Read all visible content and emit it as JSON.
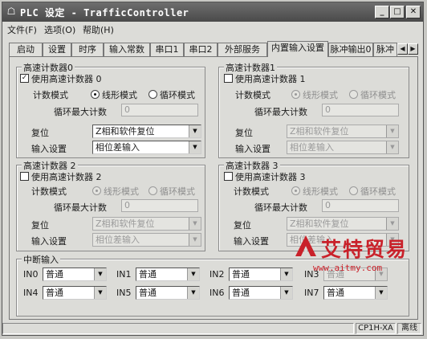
{
  "window": {
    "icon": "plc-icon",
    "title": "PLC 设定 - TrafficController"
  },
  "menu": [
    "文件(F)",
    "选项(O)",
    "帮助(H)"
  ],
  "tabs": [
    "启动",
    "设置",
    "时序",
    "输入常数",
    "串口1",
    "串口2",
    "外部服务",
    "内置输入设置",
    "脉冲输出0",
    "脉冲"
  ],
  "active_tab": "内置输入设置",
  "counters": [
    {
      "title": "高速计数器0",
      "use_label": "使用高速计数器 0",
      "use_checked": true,
      "mode_label": "计数模式",
      "mode_linear": "线形模式",
      "mode_loop": "循环模式",
      "mode_selected": "linear",
      "enabled": true,
      "max_label": "循环最大计数",
      "max_value": "0",
      "reset_label": "复位",
      "reset_value": "Z相和软件复位",
      "input_label": "输入设置",
      "input_value": "相位差输入"
    },
    {
      "title": "高速计数器1",
      "use_label": "使用高速计数器 1",
      "use_checked": false,
      "mode_label": "计数模式",
      "mode_linear": "线形模式",
      "mode_loop": "循环模式",
      "mode_selected": "linear",
      "enabled": false,
      "max_label": "循环最大计数",
      "max_value": "0",
      "reset_label": "复位",
      "reset_value": "Z相和软件复位",
      "input_label": "输入设置",
      "input_value": "相位差输入"
    },
    {
      "title": "高速计数器 2",
      "use_label": "使用高速计数器 2",
      "use_checked": false,
      "mode_label": "计数模式",
      "mode_linear": "线形模式",
      "mode_loop": "循环模式",
      "mode_selected": "linear",
      "enabled": false,
      "max_label": "循环最大计数",
      "max_value": "0",
      "reset_label": "复位",
      "reset_value": "Z相和软件复位",
      "input_label": "输入设置",
      "input_value": "相位差输入"
    },
    {
      "title": "高速计数器 3",
      "use_label": "使用高速计数器 3",
      "use_checked": false,
      "mode_label": "计数模式",
      "mode_linear": "线形模式",
      "mode_loop": "循环模式",
      "mode_selected": "linear",
      "enabled": false,
      "max_label": "循环最大计数",
      "max_value": "0",
      "reset_label": "复位",
      "reset_value": "Z相和软件复位",
      "input_label": "输入设置",
      "input_value": "相位差输入"
    }
  ],
  "interrupt": {
    "title": "中断输入",
    "inputs": [
      {
        "label": "IN0",
        "value": "普通",
        "enabled": true
      },
      {
        "label": "IN1",
        "value": "普通",
        "enabled": true
      },
      {
        "label": "IN2",
        "value": "普通",
        "enabled": true
      },
      {
        "label": "IN3",
        "value": "普通",
        "enabled": false
      },
      {
        "label": "IN4",
        "value": "普通",
        "enabled": true
      },
      {
        "label": "IN5",
        "value": "普通",
        "enabled": true
      },
      {
        "label": "IN6",
        "value": "普通",
        "enabled": true
      },
      {
        "label": "IN7",
        "value": "普通",
        "enabled": true
      }
    ]
  },
  "status": {
    "cpu": "CP1H-XA",
    "mode": "离线"
  },
  "watermark": {
    "cn": "艾特贸易",
    "url": "www.aitmy.com"
  },
  "colors": {
    "titlebar": "#5a5a5a",
    "panel": "#dcdcd8",
    "watermark": "#c9212a"
  }
}
